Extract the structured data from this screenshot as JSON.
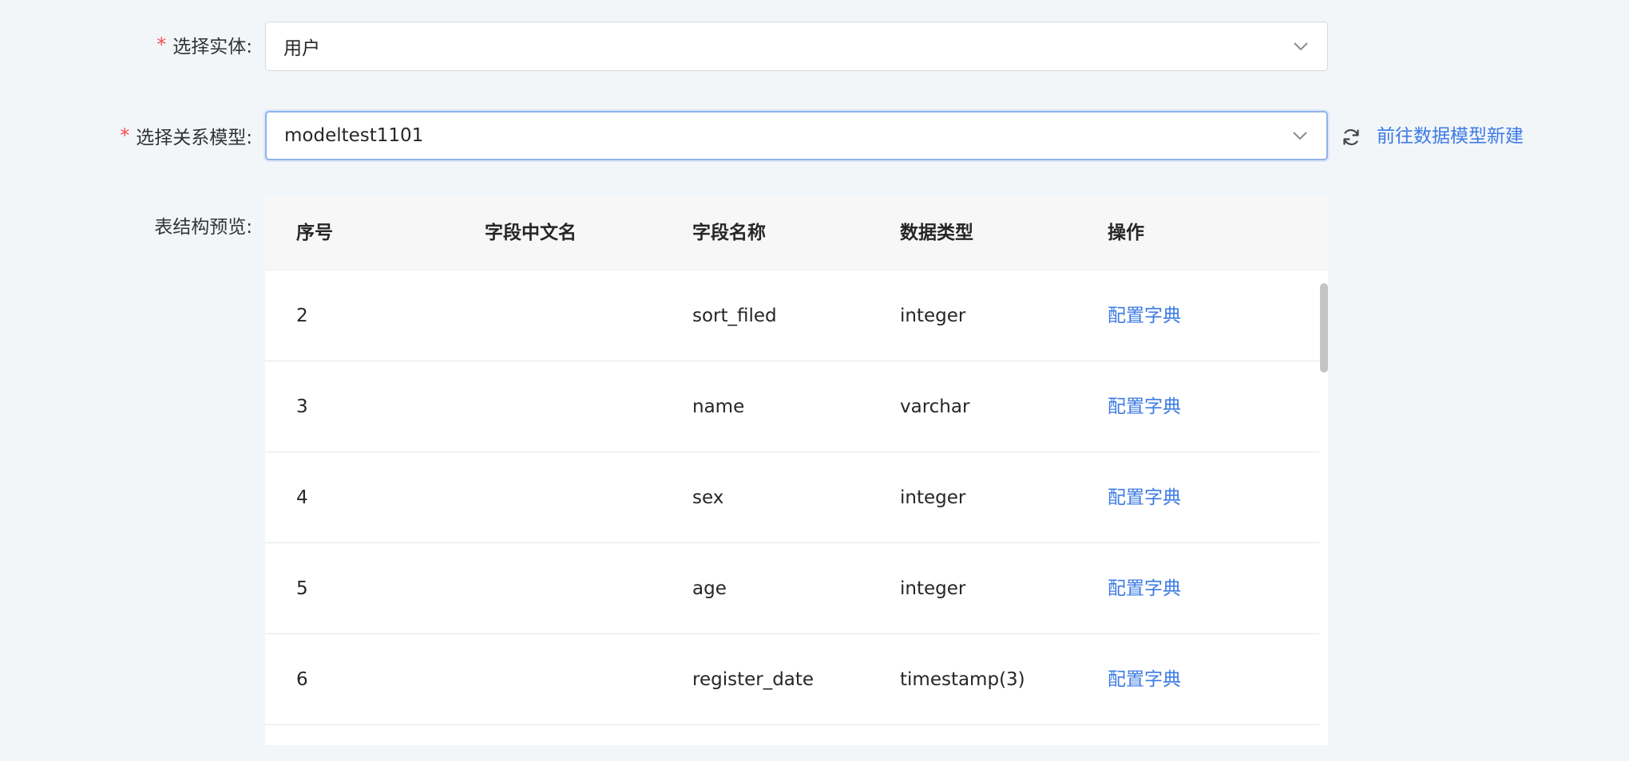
{
  "entity": {
    "required_mark": "*",
    "label": "选择实体:",
    "value": "用户"
  },
  "model": {
    "required_mark": "*",
    "label": "选择关系模型:",
    "value": "modeltest1101",
    "new_link": "前往数据模型新建"
  },
  "preview": {
    "label": "表结构预览:",
    "columns": [
      "序号",
      "字段中文名",
      "字段名称",
      "数据类型",
      "操作"
    ],
    "rows": [
      {
        "index": "2",
        "cn_name": "",
        "name": "sort_filed",
        "type": "integer",
        "action": "配置字典"
      },
      {
        "index": "3",
        "cn_name": "",
        "name": "name",
        "type": "varchar",
        "action": "配置字典"
      },
      {
        "index": "4",
        "cn_name": "",
        "name": "sex",
        "type": "integer",
        "action": "配置字典"
      },
      {
        "index": "5",
        "cn_name": "",
        "name": "age",
        "type": "integer",
        "action": "配置字典"
      },
      {
        "index": "6",
        "cn_name": "",
        "name": "register_date",
        "type": "timestamp(3)",
        "action": "配置字典"
      }
    ]
  },
  "icons": {
    "select_arrow": "chevron-down-icon",
    "refresh": "refresh-icon"
  },
  "colors": {
    "link": "#3d7be4",
    "required": "#f0504f",
    "focus_border": "#8fb2ec"
  }
}
